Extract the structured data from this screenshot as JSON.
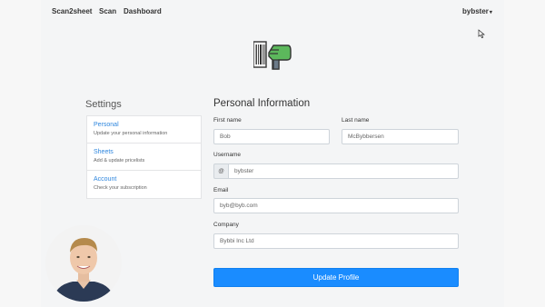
{
  "nav": {
    "brand": "Scan2sheet",
    "links": [
      "Scan",
      "Dashboard"
    ],
    "user": "bybster",
    "user_caret": "▾"
  },
  "settings": {
    "title": "Settings",
    "items": [
      {
        "title": "Personal",
        "subtitle": "Update your personal information"
      },
      {
        "title": "Sheets",
        "subtitle": "Add & update pricelists"
      },
      {
        "title": "Account",
        "subtitle": "Check your subscription"
      }
    ]
  },
  "personal_info": {
    "title": "Personal Information",
    "first_name": {
      "label": "First name",
      "value": "Bob"
    },
    "last_name": {
      "label": "Last name",
      "value": "McBybbersen"
    },
    "username": {
      "label": "Username",
      "prefix": "@",
      "value": "bybster"
    },
    "email": {
      "label": "Email",
      "value": "byb@byb.com"
    },
    "company": {
      "label": "Company",
      "value": "Bybbi Inc Ltd"
    },
    "submit_label": "Update Profile"
  },
  "colors": {
    "link_blue": "#2e86de",
    "button_blue": "#1a8cff",
    "scanner_green": "#5cb85c"
  },
  "icons": {
    "logo": "barcode-scanner-icon",
    "cursor": "mouse-pointer-icon",
    "user_caret": "caret-down-icon"
  }
}
